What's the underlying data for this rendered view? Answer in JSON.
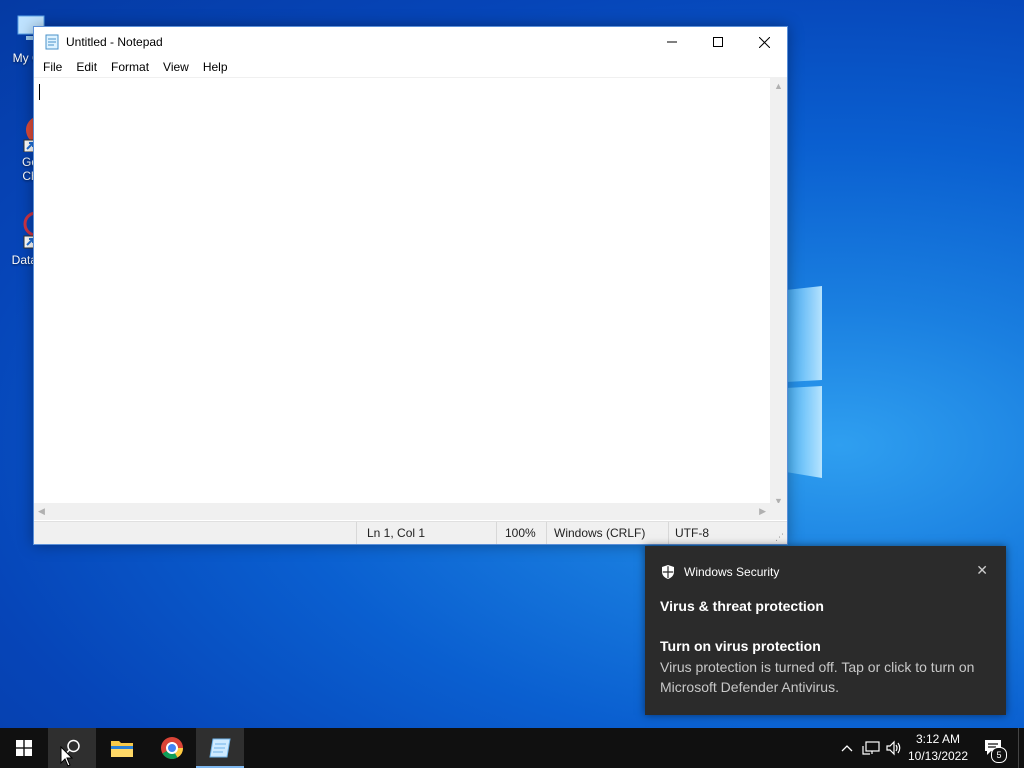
{
  "desktop": {
    "icons": [
      {
        "label": "My Co",
        "name": "my-computer"
      },
      {
        "label": "Go\nCh",
        "name": "google-chrome"
      },
      {
        "label": "DataW",
        "name": "dataw"
      }
    ]
  },
  "notepad": {
    "title": "Untitled - Notepad",
    "menu": [
      "File",
      "Edit",
      "Format",
      "View",
      "Help"
    ],
    "content": "",
    "status": {
      "position": "Ln 1, Col 1",
      "zoom": "100%",
      "line_ending": "Windows (CRLF)",
      "encoding": "UTF-8"
    }
  },
  "toast": {
    "app": "Windows Security",
    "heading": "Virus & threat protection",
    "title": "Turn on virus protection",
    "body": "Virus protection is turned off. Tap or click to turn on Microsoft Defender Antivirus."
  },
  "taskbar": {
    "time": "3:12 AM",
    "date": "10/13/2022",
    "notification_count": "5",
    "apps": [
      "start",
      "search",
      "file-explorer",
      "chrome",
      "notepad"
    ]
  },
  "colors": {
    "accent": "#0a5fd0",
    "toast_bg": "#2b2b2b",
    "taskbar_bg": "#101010"
  }
}
